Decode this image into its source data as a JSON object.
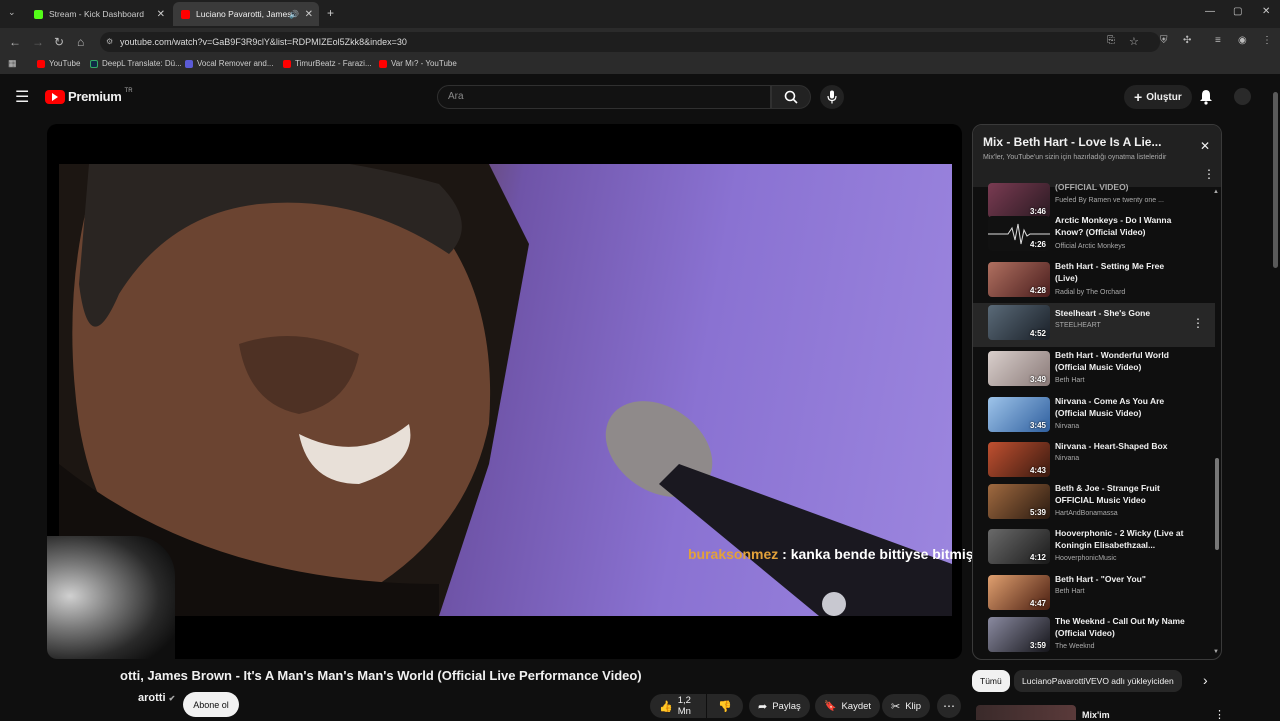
{
  "browser": {
    "tabs": [
      {
        "title": "Stream - Kick Dashboard",
        "fav_color": "#53fc18"
      },
      {
        "title": "Luciano Pavarotti, James Bro",
        "fav_color": "#ff0000"
      }
    ],
    "url": "youtube.com/watch?v=GaB9F3R9clY&list=RDPMIZEol5Zkk8&index=30",
    "bookmarks": [
      {
        "label": "YouTube",
        "color": "#ff0000"
      },
      {
        "label": "DeepL Translate: Dü...",
        "color": "#0f2b46"
      },
      {
        "label": "Vocal Remover and...",
        "color": "#5b5bd6"
      },
      {
        "label": "TimurBeatz - Farazi...",
        "color": "#ff0000"
      },
      {
        "label": "Var Mı? - YouTube",
        "color": "#ff0000"
      }
    ]
  },
  "header": {
    "logo": "Premium",
    "logo_sup": "TR",
    "search_placeholder": "Ara",
    "create_label": "Oluştur"
  },
  "video": {
    "title": "otti, James Brown - It's A Man's Man's Man's World (Official Live Performance Video)",
    "channel": "arotti",
    "subscribe_label": "Abone ol",
    "like_count": "1,2 Mn",
    "share_label": "Paylaş",
    "save_label": "Kaydet",
    "clip_label": "Klip",
    "chat_user": "buraksonmez",
    "chat_message": ": kanka bende bittiyse bitmiştir"
  },
  "playlist": {
    "title": "Mix - Beth Hart - Love Is A Lie...",
    "subtitle": "Mix'ler, YouTube'un sizin için hazırladığı oynatma listeleridir",
    "items": [
      {
        "title": "(OFFICIAL VIDEO)",
        "channel": "Fueled By Ramen ve twenty one ...",
        "duration": "3:46",
        "color": "#7a3b52"
      },
      {
        "title": "Arctic Monkeys - Do I Wanna Know? (Official Video)",
        "channel": "Official Arctic Monkeys",
        "duration": "4:26",
        "color": "#111111"
      },
      {
        "title": "Beth Hart - Setting Me Free (Live)",
        "channel": "Radial by The Orchard",
        "duration": "4:28",
        "color": "#6b2a2a"
      },
      {
        "title": "Steelheart - She's Gone",
        "channel": "STEELHEART",
        "duration": "4:52",
        "color": "#2a3440"
      },
      {
        "title": "Beth Hart - Wonderful World (Official Music Video)",
        "channel": "Beth Hart",
        "duration": "3:49",
        "color": "#b5a6a3"
      },
      {
        "title": "Nirvana - Come As You Are (Official Music Video)",
        "channel": "Nirvana",
        "duration": "3:45",
        "color": "#4a78b8"
      },
      {
        "title": "Nirvana - Heart-Shaped Box",
        "channel": "Nirvana",
        "duration": "4:43",
        "color": "#8a2a1e"
      },
      {
        "title": "Beth & Joe - Strange Fruit OFFICIAL Music Video",
        "channel": "HartAndBonamassa",
        "duration": "5:39",
        "color": "#4a2e1c"
      },
      {
        "title": "Hooverphonic - 2 Wicky (Live at Koningin Elisabethzaal...",
        "channel": "HooverphonicMusic",
        "duration": "4:12",
        "color": "#333333"
      },
      {
        "title": "Beth Hart - \"Over You\"",
        "channel": "Beth Hart",
        "duration": "4:47",
        "color": "#5a2a1c"
      },
      {
        "title": "The Weeknd - Call Out My Name (Official Video)",
        "channel": "The Weeknd",
        "duration": "3:59",
        "color": "#2a2a30"
      }
    ]
  },
  "chips": {
    "all": "Tümü",
    "uploader": "LucianoPavarottiVEVO adlı yükleyiciden"
  },
  "below": {
    "next_title": "Mix'im"
  }
}
